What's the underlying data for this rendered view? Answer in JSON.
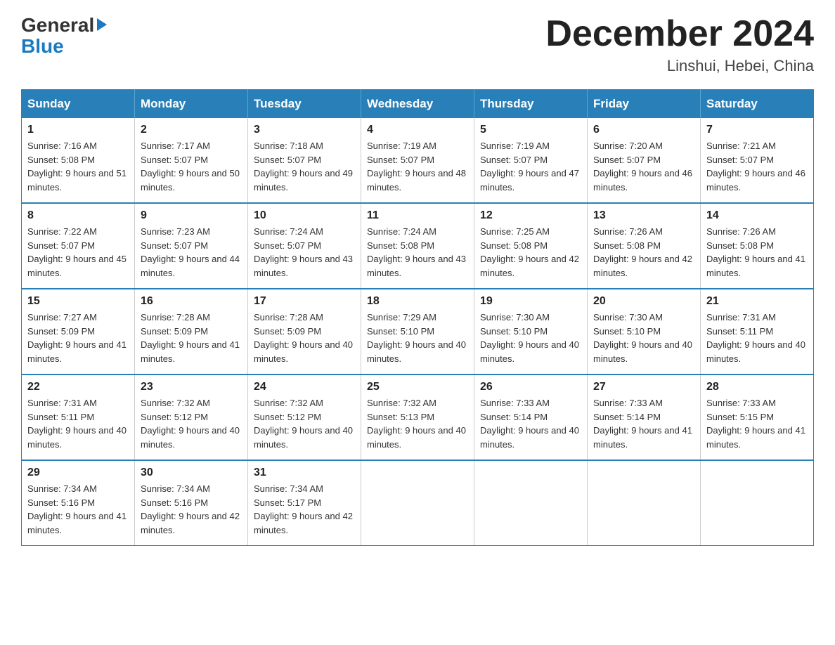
{
  "header": {
    "logo_general": "General",
    "logo_blue": "Blue",
    "month_title": "December 2024",
    "location": "Linshui, Hebei, China"
  },
  "weekdays": [
    "Sunday",
    "Monday",
    "Tuesday",
    "Wednesday",
    "Thursday",
    "Friday",
    "Saturday"
  ],
  "weeks": [
    [
      {
        "day": "1",
        "sunrise": "7:16 AM",
        "sunset": "5:08 PM",
        "daylight": "9 hours and 51 minutes."
      },
      {
        "day": "2",
        "sunrise": "7:17 AM",
        "sunset": "5:07 PM",
        "daylight": "9 hours and 50 minutes."
      },
      {
        "day": "3",
        "sunrise": "7:18 AM",
        "sunset": "5:07 PM",
        "daylight": "9 hours and 49 minutes."
      },
      {
        "day": "4",
        "sunrise": "7:19 AM",
        "sunset": "5:07 PM",
        "daylight": "9 hours and 48 minutes."
      },
      {
        "day": "5",
        "sunrise": "7:19 AM",
        "sunset": "5:07 PM",
        "daylight": "9 hours and 47 minutes."
      },
      {
        "day": "6",
        "sunrise": "7:20 AM",
        "sunset": "5:07 PM",
        "daylight": "9 hours and 46 minutes."
      },
      {
        "day": "7",
        "sunrise": "7:21 AM",
        "sunset": "5:07 PM",
        "daylight": "9 hours and 46 minutes."
      }
    ],
    [
      {
        "day": "8",
        "sunrise": "7:22 AM",
        "sunset": "5:07 PM",
        "daylight": "9 hours and 45 minutes."
      },
      {
        "day": "9",
        "sunrise": "7:23 AM",
        "sunset": "5:07 PM",
        "daylight": "9 hours and 44 minutes."
      },
      {
        "day": "10",
        "sunrise": "7:24 AM",
        "sunset": "5:07 PM",
        "daylight": "9 hours and 43 minutes."
      },
      {
        "day": "11",
        "sunrise": "7:24 AM",
        "sunset": "5:08 PM",
        "daylight": "9 hours and 43 minutes."
      },
      {
        "day": "12",
        "sunrise": "7:25 AM",
        "sunset": "5:08 PM",
        "daylight": "9 hours and 42 minutes."
      },
      {
        "day": "13",
        "sunrise": "7:26 AM",
        "sunset": "5:08 PM",
        "daylight": "9 hours and 42 minutes."
      },
      {
        "day": "14",
        "sunrise": "7:26 AM",
        "sunset": "5:08 PM",
        "daylight": "9 hours and 41 minutes."
      }
    ],
    [
      {
        "day": "15",
        "sunrise": "7:27 AM",
        "sunset": "5:09 PM",
        "daylight": "9 hours and 41 minutes."
      },
      {
        "day": "16",
        "sunrise": "7:28 AM",
        "sunset": "5:09 PM",
        "daylight": "9 hours and 41 minutes."
      },
      {
        "day": "17",
        "sunrise": "7:28 AM",
        "sunset": "5:09 PM",
        "daylight": "9 hours and 40 minutes."
      },
      {
        "day": "18",
        "sunrise": "7:29 AM",
        "sunset": "5:10 PM",
        "daylight": "9 hours and 40 minutes."
      },
      {
        "day": "19",
        "sunrise": "7:30 AM",
        "sunset": "5:10 PM",
        "daylight": "9 hours and 40 minutes."
      },
      {
        "day": "20",
        "sunrise": "7:30 AM",
        "sunset": "5:10 PM",
        "daylight": "9 hours and 40 minutes."
      },
      {
        "day": "21",
        "sunrise": "7:31 AM",
        "sunset": "5:11 PM",
        "daylight": "9 hours and 40 minutes."
      }
    ],
    [
      {
        "day": "22",
        "sunrise": "7:31 AM",
        "sunset": "5:11 PM",
        "daylight": "9 hours and 40 minutes."
      },
      {
        "day": "23",
        "sunrise": "7:32 AM",
        "sunset": "5:12 PM",
        "daylight": "9 hours and 40 minutes."
      },
      {
        "day": "24",
        "sunrise": "7:32 AM",
        "sunset": "5:12 PM",
        "daylight": "9 hours and 40 minutes."
      },
      {
        "day": "25",
        "sunrise": "7:32 AM",
        "sunset": "5:13 PM",
        "daylight": "9 hours and 40 minutes."
      },
      {
        "day": "26",
        "sunrise": "7:33 AM",
        "sunset": "5:14 PM",
        "daylight": "9 hours and 40 minutes."
      },
      {
        "day": "27",
        "sunrise": "7:33 AM",
        "sunset": "5:14 PM",
        "daylight": "9 hours and 41 minutes."
      },
      {
        "day": "28",
        "sunrise": "7:33 AM",
        "sunset": "5:15 PM",
        "daylight": "9 hours and 41 minutes."
      }
    ],
    [
      {
        "day": "29",
        "sunrise": "7:34 AM",
        "sunset": "5:16 PM",
        "daylight": "9 hours and 41 minutes."
      },
      {
        "day": "30",
        "sunrise": "7:34 AM",
        "sunset": "5:16 PM",
        "daylight": "9 hours and 42 minutes."
      },
      {
        "day": "31",
        "sunrise": "7:34 AM",
        "sunset": "5:17 PM",
        "daylight": "9 hours and 42 minutes."
      },
      null,
      null,
      null,
      null
    ]
  ]
}
